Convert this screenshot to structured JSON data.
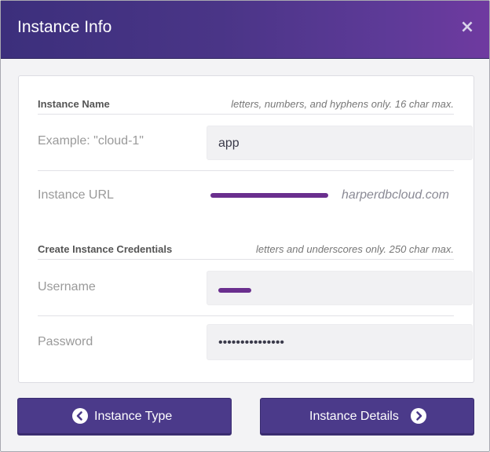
{
  "header": {
    "title": "Instance Info",
    "close_label": "×"
  },
  "instance_name": {
    "section_title": "Instance Name",
    "hint": "letters, numbers, and hyphens only. 16 char max.",
    "placeholder_label": "Example: \"cloud-1\"",
    "value": "app"
  },
  "instance_url": {
    "label": "Instance URL",
    "value": "harperdbcloud.com"
  },
  "credentials": {
    "section_title": "Create Instance Credentials",
    "hint": "letters and underscores only. 250 char max.",
    "username_label": "Username",
    "username_value": "",
    "password_label": "Password",
    "password_value": "•••••••••••••••"
  },
  "buttons": {
    "back_label": "Instance Type",
    "next_label": "Instance Details"
  },
  "colors": {
    "header_start": "#3c2f7c",
    "header_end": "#6f3aa0",
    "button": "#4b3a8a",
    "redaction": "#6a2f8e"
  }
}
